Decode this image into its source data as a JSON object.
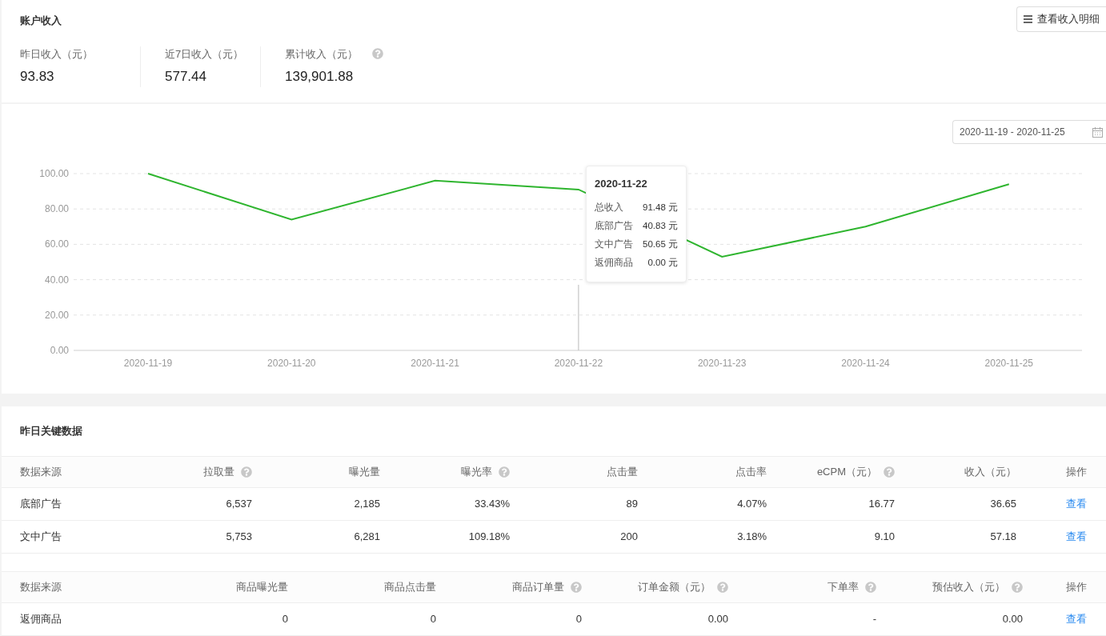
{
  "account": {
    "title": "账户收入",
    "detail_button": "查看收入明细",
    "stats": [
      {
        "label": "昨日收入（元）",
        "value": "93.83",
        "help": false
      },
      {
        "label": "近7日收入（元）",
        "value": "577.44",
        "help": false
      },
      {
        "label": "累计收入（元）",
        "value": "139,901.88",
        "help": true
      }
    ]
  },
  "trend": {
    "date_range": "2020-11-19 - 2020-11-25",
    "chart_data": {
      "type": "line",
      "categories": [
        "2020-11-19",
        "2020-11-20",
        "2020-11-21",
        "2020-11-22",
        "2020-11-23",
        "2020-11-24",
        "2020-11-25"
      ],
      "series": [
        {
          "color": "#2fb52f",
          "values": [
            100,
            74,
            96,
            91,
            53,
            70,
            94
          ]
        }
      ],
      "grid": true,
      "ylim": [
        0,
        100
      ],
      "yticks": [
        {
          "value": 0,
          "label": "0.00"
        },
        {
          "value": 20,
          "label": "20.00"
        },
        {
          "value": 40,
          "label": "40.00"
        },
        {
          "value": 60,
          "label": "60.00"
        },
        {
          "value": 80,
          "label": "80.00"
        },
        {
          "value": 100,
          "label": "100.00"
        }
      ]
    },
    "tooltip": {
      "title": "2020-11-22",
      "rows": [
        {
          "label": "总收入",
          "value": "91.48 元"
        },
        {
          "label": "底部广告",
          "value": "40.83 元"
        },
        {
          "label": "文中广告",
          "value": "50.65 元"
        },
        {
          "label": "返佣商品",
          "value": "0.00 元"
        }
      ]
    }
  },
  "key_data": {
    "title": "昨日关键数据",
    "tables": [
      {
        "columns": [
          {
            "label": "数据来源",
            "help": false
          },
          {
            "label": "拉取量",
            "help": true
          },
          {
            "label": "曝光量",
            "help": false
          },
          {
            "label": "曝光率",
            "help": true
          },
          {
            "label": "点击量",
            "help": false
          },
          {
            "label": "点击率",
            "help": false
          },
          {
            "label": "eCPM（元）",
            "help": true
          },
          {
            "label": "收入（元）",
            "help": false
          },
          {
            "label": "操作",
            "help": false
          }
        ],
        "rows": [
          {
            "cells": [
              "底部广告",
              "6,537",
              "2,185",
              "33.43%",
              "89",
              "4.07%",
              "16.77",
              "36.65"
            ],
            "action": "查看"
          },
          {
            "cells": [
              "文中广告",
              "5,753",
              "6,281",
              "109.18%",
              "200",
              "3.18%",
              "9.10",
              "57.18"
            ],
            "action": "查看"
          }
        ]
      },
      {
        "columns": [
          {
            "label": "数据来源",
            "help": false
          },
          {
            "label": "商品曝光量",
            "help": false
          },
          {
            "label": "商品点击量",
            "help": false
          },
          {
            "label": "商品订单量",
            "help": true
          },
          {
            "label": "订单金额（元）",
            "help": true
          },
          {
            "label": "下单率",
            "help": true
          },
          {
            "label": "预估收入（元）",
            "help": true
          },
          {
            "label": "操作",
            "help": false
          }
        ],
        "rows": [
          {
            "cells": [
              "返佣商品",
              "0",
              "0",
              "0",
              "0.00",
              "-",
              "0.00"
            ],
            "action": "查看"
          }
        ]
      }
    ]
  }
}
